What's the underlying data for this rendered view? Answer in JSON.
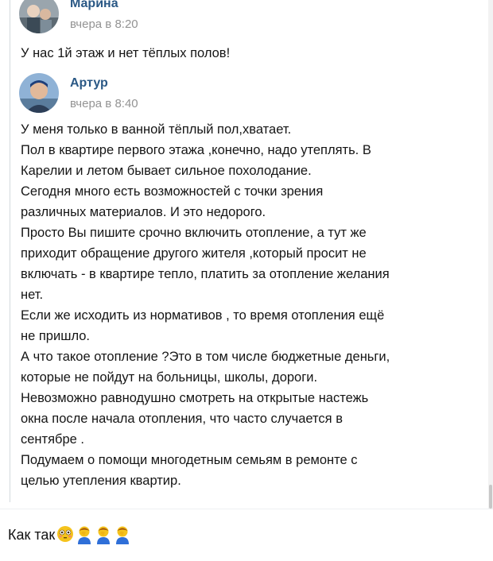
{
  "messages": [
    {
      "author": "Марина",
      "time": "вчера в 8:20",
      "text": "У нас 1й этаж и нет тёплых полов!"
    },
    {
      "author": "Артур",
      "time": "вчера в 8:40",
      "lines": [
        "У меня только в ванной тёплый пол,хватает.",
        "Пол в квартире первого этажа ,конечно, надо утеплять. В",
        "Карелии и летом бывает сильное похолодание.",
        "Сегодня много есть возможностей с точки зрения",
        "различных материалов. И это недорого.",
        "Просто Вы пишите срочно включить отопление, а тут же",
        "приходит обращение другого жителя ,который просит не",
        "включать - в квартире тепло, платить за отопление желания",
        "нет.",
        "Если же исходить из нормативов , то время отопления ещё",
        "не пришло.",
        "А что такое отопление ?Это в том числе бюджетные деньги,",
        "которые не пойдут на больницы, школы, дороги.",
        "Невозможно равнодушно смотреть на открытые настежь",
        "окна после начала отопления, что часто случается в",
        "сентябре .",
        "Подумаем о помощи многодетным семьям в ремонте с",
        "целью утепления квартир."
      ]
    }
  ],
  "caption": {
    "text": "Как так",
    "emojis": [
      "flushed-face-emoji",
      "man-facepalming-emoji",
      "man-facepalming-emoji",
      "man-facepalming-emoji"
    ]
  },
  "colors": {
    "author_link": "#2a5885",
    "timestamp": "#939393",
    "divider": "#d3d9de",
    "emoji_yellow": "#f5c31c"
  }
}
